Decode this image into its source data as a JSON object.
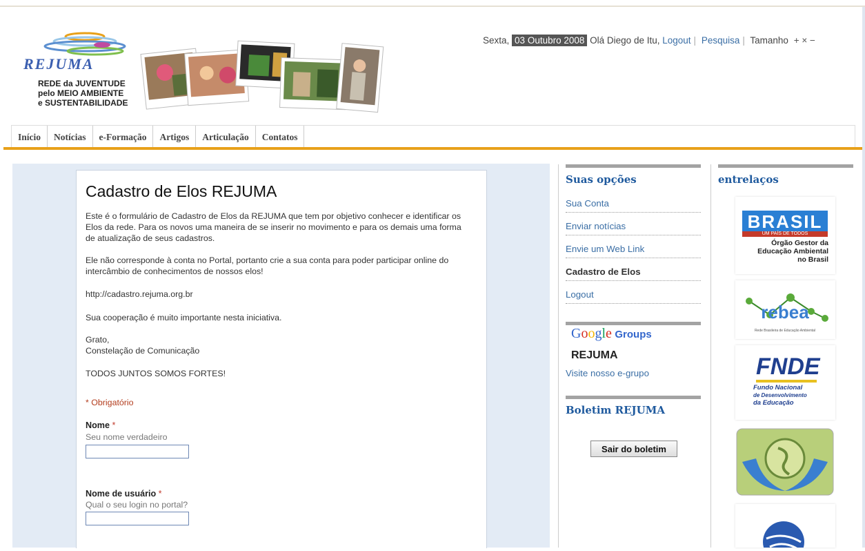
{
  "logo": {
    "word": "REJUMA",
    "lines": [
      "REDE da JUVENTUDE",
      "pelo MEIO AMBIENTE",
      "e SUSTENTABILIDADE"
    ]
  },
  "topbar": {
    "day": "Sexta,",
    "date": "03 Outubro 2008",
    "greeting": "Olá Diego de Itu,",
    "logout": "Logout",
    "search": "Pesquisa",
    "size_label": "Tamanho",
    "size_controls": "+ × −"
  },
  "nav": [
    "Início",
    "Notícias",
    "e-Formação",
    "Artigos",
    "Articulação",
    "Contatos"
  ],
  "article": {
    "title": "Cadastro de Elos REJUMA",
    "p1": "Este é o formulário de Cadastro de Elos da REJUMA que tem por objetivo conhecer e identificar os Elos da rede. Para os novos uma maneira de se inserir no movimento e para os demais uma forma de atualização de seus cadastros.",
    "p2": "Ele não corresponde à conta no Portal, portanto crie a sua conta para poder participar online do intercâmbio de conhecimentos de nossos elos!",
    "p3": "http://cadastro.rejuma.org.br",
    "p4": "Sua cooperação é muito importante nesta iniciativa.",
    "p5a": "Grato,",
    "p5b": "Constelação de Comunicação",
    "p6": "TODOS JUNTOS SOMOS FORTES!",
    "required_note": "* Obrigatório",
    "fields": [
      {
        "label": "Nome",
        "star": "*",
        "help": "Seu nome verdadeiro",
        "value": ""
      },
      {
        "label": "Nome de usuário",
        "star": "*",
        "help": "Qual o seu login no portal?",
        "value": ""
      }
    ]
  },
  "options": {
    "title": "Suas opções",
    "items": [
      "Sua Conta",
      "Enviar notícias",
      "Envie um Web Link",
      "Cadastro de Elos",
      "Logout"
    ]
  },
  "google_groups": {
    "google": "Google",
    "groups": "Groups",
    "group_name": "REJUMA",
    "link": "Visite nosso e-grupo"
  },
  "boletim": {
    "title": "Boletim REJUMA",
    "button": "Sair do boletim"
  },
  "entrelacos": {
    "title": "entrelaços",
    "brasil_word": "BRASIL",
    "brasil_tag": "UM PAÍS DE TODOS",
    "brasil_text": [
      "Órgão Gestor da",
      "Educação Ambiental",
      "no Brasil"
    ],
    "rebea_word": "rebea",
    "rebea_sub": "Rede Brasileira de Educação Ambiental",
    "fnde_word": "FNDE",
    "fnde_text": [
      "Fundo Nacional",
      "de Desenvolvimento",
      "da Educação"
    ]
  }
}
